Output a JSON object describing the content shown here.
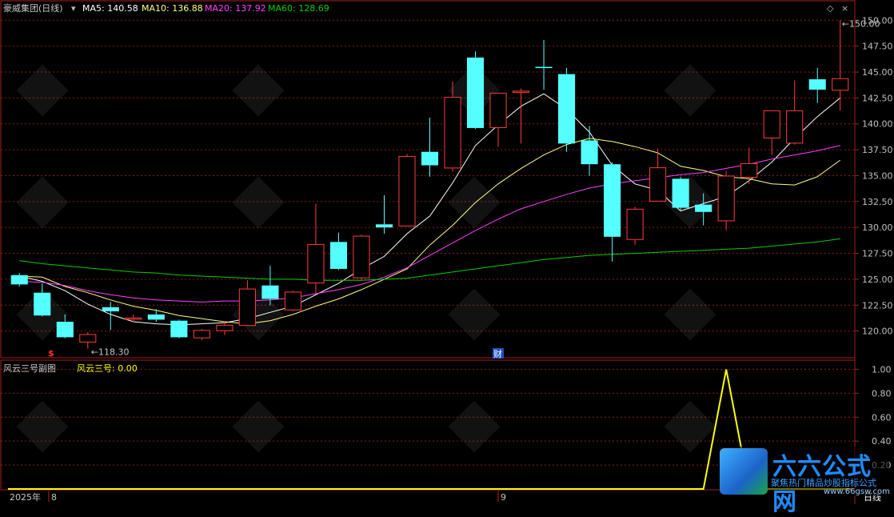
{
  "colors": {
    "up": "#ff3c3c",
    "down": "#54ffff",
    "ma5": "#ffffff",
    "ma10": "#ffff80",
    "ma20": "#ff40ff",
    "ma60": "#00d000",
    "indicator": "#ffff00",
    "grid": "#8b1a1a",
    "frame": "#a02020"
  },
  "header": {
    "stock_name": "豪威集团(日线)",
    "ma5": "MA5: 140.58",
    "ma10": "MA10: 136.88",
    "ma20": "MA20: 137.92",
    "ma60": "MA60: 128.69"
  },
  "annotations": {
    "high_label": "150.00",
    "low_label": "118.30",
    "marker_s": "$",
    "marker_cai": "财"
  },
  "sub_header": {
    "title": "风云三号副图",
    "value": "风云三号: 0.00"
  },
  "footer": {
    "year_label": "2025年",
    "month_8": "8",
    "month_9": "9",
    "period": "日线"
  },
  "logo": {
    "name": "六六公式网",
    "slogan": "聚焦热门精品炒股指标公式",
    "url": "www.66gsw.com"
  },
  "chart_data": [
    {
      "type": "candlestick",
      "ylim": [
        117.5,
        151.8
      ],
      "y_ticks": [
        120.0,
        122.5,
        125.0,
        127.5,
        130.0,
        132.5,
        135.0,
        137.5,
        140.0,
        142.5,
        145.0,
        147.5,
        150.0
      ],
      "candles": [
        {
          "o": 125.4,
          "h": 125.6,
          "l": 124.3,
          "c": 124.5
        },
        {
          "o": 123.7,
          "h": 124.6,
          "l": 121.4,
          "c": 121.5
        },
        {
          "o": 120.9,
          "h": 121.6,
          "l": 119.3,
          "c": 119.4
        },
        {
          "o": 118.9,
          "h": 119.9,
          "l": 118.3,
          "c": 119.7
        },
        {
          "o": 122.3,
          "h": 122.8,
          "l": 120.1,
          "c": 121.9
        },
        {
          "o": 121.1,
          "h": 121.6,
          "l": 120.9,
          "c": 121.3
        },
        {
          "o": 121.6,
          "h": 122.1,
          "l": 120.9,
          "c": 121.1
        },
        {
          "o": 121.0,
          "h": 121.1,
          "l": 119.3,
          "c": 119.4
        },
        {
          "o": 119.3,
          "h": 120.2,
          "l": 119.1,
          "c": 120.1
        },
        {
          "o": 120.0,
          "h": 120.9,
          "l": 119.6,
          "c": 120.6
        },
        {
          "o": 120.5,
          "h": 124.9,
          "l": 120.5,
          "c": 124.1
        },
        {
          "o": 124.4,
          "h": 126.3,
          "l": 122.5,
          "c": 123.1
        },
        {
          "o": 122.0,
          "h": 123.9,
          "l": 121.9,
          "c": 123.8
        },
        {
          "o": 124.6,
          "h": 132.3,
          "l": 123.6,
          "c": 128.4
        },
        {
          "o": 128.6,
          "h": 129.5,
          "l": 125.9,
          "c": 126.0
        },
        {
          "o": 125.1,
          "h": 129.3,
          "l": 125.0,
          "c": 129.2
        },
        {
          "o": 130.3,
          "h": 133.1,
          "l": 129.4,
          "c": 130.0
        },
        {
          "o": 130.1,
          "h": 137.1,
          "l": 130.1,
          "c": 136.9
        },
        {
          "o": 137.3,
          "h": 140.6,
          "l": 134.9,
          "c": 136.0
        },
        {
          "o": 135.7,
          "h": 144.1,
          "l": 135.4,
          "c": 142.6
        },
        {
          "o": 146.4,
          "h": 147.0,
          "l": 139.5,
          "c": 139.6
        },
        {
          "o": 139.6,
          "h": 143.0,
          "l": 137.8,
          "c": 143.0
        },
        {
          "o": 143.0,
          "h": 143.4,
          "l": 138.1,
          "c": 143.2
        },
        {
          "o": 145.5,
          "h": 148.1,
          "l": 143.3,
          "c": 145.4
        },
        {
          "o": 144.8,
          "h": 145.4,
          "l": 137.3,
          "c": 138.1
        },
        {
          "o": 138.4,
          "h": 139.8,
          "l": 135.0,
          "c": 136.1
        },
        {
          "o": 136.1,
          "h": 136.3,
          "l": 126.7,
          "c": 129.1
        },
        {
          "o": 128.8,
          "h": 132.0,
          "l": 128.3,
          "c": 131.8
        },
        {
          "o": 132.5,
          "h": 137.6,
          "l": 132.5,
          "c": 135.8
        },
        {
          "o": 134.7,
          "h": 134.9,
          "l": 131.7,
          "c": 131.9
        },
        {
          "o": 132.2,
          "h": 133.3,
          "l": 130.2,
          "c": 131.5
        },
        {
          "o": 130.6,
          "h": 135.4,
          "l": 129.7,
          "c": 135.0
        },
        {
          "o": 134.8,
          "h": 137.7,
          "l": 134.2,
          "c": 136.2
        },
        {
          "o": 138.6,
          "h": 140.2,
          "l": 137.0,
          "c": 141.3
        },
        {
          "o": 138.1,
          "h": 144.2,
          "l": 138.0,
          "c": 141.3
        },
        {
          "o": 144.3,
          "h": 145.4,
          "l": 142.0,
          "c": 143.3
        },
        {
          "o": 143.2,
          "h": 150.0,
          "l": 141.3,
          "c": 144.4
        }
      ],
      "series": [
        {
          "name": "MA5",
          "values": [
            125.3,
            124.8,
            123.9,
            122.6,
            121.6,
            120.9,
            120.7,
            120.6,
            120.7,
            120.8,
            121.2,
            121.8,
            122.4,
            123.5,
            124.6,
            126.0,
            127.2,
            129.4,
            131.1,
            134.3,
            137.9,
            139.9,
            141.7,
            142.9,
            141.4,
            139.2,
            136.0,
            134.2,
            133.6,
            131.6,
            132.3,
            133.0,
            134.5,
            136.3,
            138.6,
            140.7,
            142.5
          ]
        },
        {
          "name": "MA10",
          "values": [
            125.3,
            125.2,
            124.3,
            123.7,
            123.0,
            122.4,
            122.0,
            121.5,
            121.2,
            120.9,
            120.7,
            121.0,
            121.6,
            122.4,
            123.1,
            124.0,
            125.0,
            126.0,
            128.3,
            130.2,
            132.4,
            134.2,
            135.7,
            137.0,
            138.0,
            138.6,
            138.3,
            137.8,
            137.2,
            135.9,
            135.5,
            134.9,
            134.7,
            134.2,
            134.1,
            134.9,
            136.5
          ]
        },
        {
          "name": "MA20",
          "values": [
            124.8,
            124.7,
            124.4,
            123.9,
            123.5,
            123.2,
            123.0,
            122.9,
            122.8,
            122.9,
            122.9,
            123.0,
            123.2,
            123.6,
            124.0,
            124.5,
            125.2,
            126.1,
            127.3,
            128.5,
            129.7,
            130.8,
            131.8,
            132.5,
            133.2,
            133.8,
            134.2,
            134.5,
            134.8,
            135.1,
            135.3,
            135.7,
            136.1,
            136.6,
            137.0,
            137.4,
            137.9
          ]
        },
        {
          "name": "MA60",
          "values": [
            126.8,
            126.5,
            126.3,
            126.1,
            125.9,
            125.7,
            125.6,
            125.4,
            125.3,
            125.2,
            125.1,
            125.0,
            125.0,
            124.9,
            124.9,
            124.9,
            125.0,
            125.1,
            125.4,
            125.7,
            126.0,
            126.3,
            126.6,
            126.9,
            127.1,
            127.3,
            127.4,
            127.5,
            127.6,
            127.7,
            127.8,
            127.9,
            128.0,
            128.2,
            128.4,
            128.6,
            128.9
          ]
        }
      ]
    },
    {
      "type": "line",
      "ylim": [
        0.0,
        1.07
      ],
      "y_ticks": [
        0.2,
        0.4,
        0.6,
        0.8,
        1.0
      ],
      "series": [
        {
          "name": "风云三号",
          "values": [
            0,
            0,
            0,
            0,
            0,
            0,
            0,
            0,
            0,
            0,
            0,
            0,
            0,
            0,
            0,
            0,
            0,
            0,
            0,
            0,
            0,
            0,
            0,
            0,
            0,
            0,
            0,
            0,
            0,
            0,
            0,
            1.0,
            0,
            0,
            0,
            0,
            0
          ]
        }
      ]
    }
  ]
}
